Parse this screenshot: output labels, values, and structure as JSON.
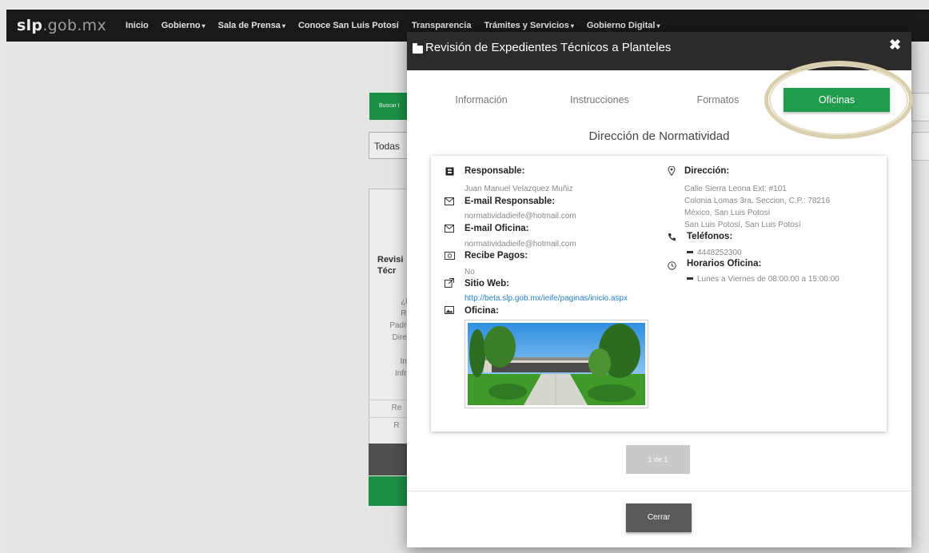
{
  "nav": {
    "logo_bold": "slp",
    "logo_rest": ".gob.mx",
    "items": [
      {
        "label": "Inicio",
        "dropdown": false
      },
      {
        "label": "Gobierno",
        "dropdown": true
      },
      {
        "label": "Sala de Prensa",
        "dropdown": true
      },
      {
        "label": "Conoce San Luis Potosí",
        "dropdown": false
      },
      {
        "label": "Transparencia",
        "dropdown": false
      },
      {
        "label": "Trámites y Servicios",
        "dropdown": true
      },
      {
        "label": "Gobierno Digital",
        "dropdown": true
      }
    ]
  },
  "background": {
    "search_button": "Buscar t",
    "filter_select": "Todas",
    "card_title": "Revisi\nTécr",
    "card_text": "¿E\nRe\nPadre\nDirec\n\nIns\nInfra",
    "row1": "Re",
    "row2": "R"
  },
  "modal": {
    "title": "Revisión de Expedientes Técnicos a Planteles",
    "tabs": [
      {
        "label": "Información",
        "active": false
      },
      {
        "label": "Instrucciones",
        "active": false
      },
      {
        "label": "Formatos",
        "active": false
      },
      {
        "label": "Oficinas",
        "active": true
      }
    ],
    "office_name": "Dirección de Normatividad",
    "left": {
      "responsable_label": "Responsable:",
      "responsable_value": "Juan Manuel Velazquez Muñiz",
      "email_resp_label": "E-mail Responsable:",
      "email_resp_value": "normatividadieife@hotmail.com",
      "email_of_label": "E-mail Oficina:",
      "email_of_value": "normatividadieife@hotmail.com",
      "pagos_label": "Recibe Pagos:",
      "pagos_value": "No",
      "web_label": "Sitio Web:",
      "web_value": "http://beta.slp.gob.mx/ieife/paginas/inicio.aspx",
      "oficina_label": "Oficina:"
    },
    "right": {
      "direccion_label": "Dirección:",
      "direccion_line1": "Calle Sierra Leona  Ext:  #101",
      "direccion_line2": "Colonia Lomas 3ra. Seccion, C.P.: 78216",
      "direccion_line3": "México, San Luis Potosí",
      "direccion_line4": "San Luis Potosí, San Luis Potosí",
      "telefonos_label": "Teléfonos:",
      "telefono_1": "4448252300",
      "horarios_label": "Horarios Oficina:",
      "horario_1": "Lunes a Viernes de 08:00:00 a 15:00:00"
    },
    "pager": "1 de 1",
    "close_button": "Cerrar"
  },
  "colors": {
    "accent_green": "#1f9c4c",
    "header_dark": "#2b2b2b",
    "link_blue": "#2a80c4"
  }
}
